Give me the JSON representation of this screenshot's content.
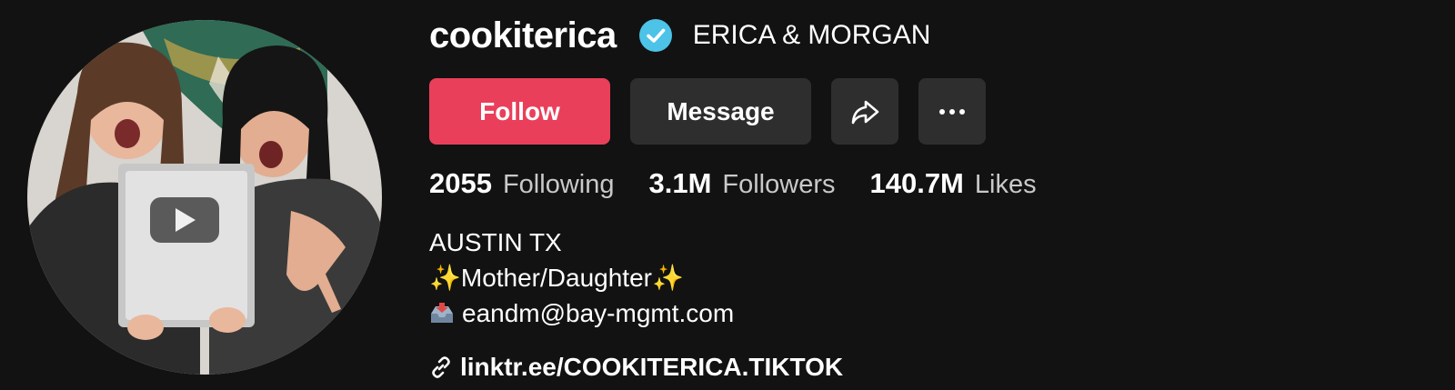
{
  "profile": {
    "username": "cookiterica",
    "display_name": "ERICA & MORGAN",
    "verified_color": "#4dc3e8"
  },
  "actions": {
    "follow_label": "Follow",
    "message_label": "Message",
    "share_icon": "share-arrow-icon",
    "more_icon": "more-dots-icon",
    "follow_color": "#ea3f5a"
  },
  "stats": [
    {
      "value": "2055",
      "label": "Following"
    },
    {
      "value": "3.1M",
      "label": "Followers"
    },
    {
      "value": "140.7M",
      "label": "Likes"
    }
  ],
  "bio": {
    "line1": "AUSTIN TX",
    "line2": "✨Mother/Daughter✨",
    "line3": "eandm@bay-mgmt.com"
  },
  "link": {
    "text": "linktr.ee/COOKITERICA.TIKTOK"
  }
}
